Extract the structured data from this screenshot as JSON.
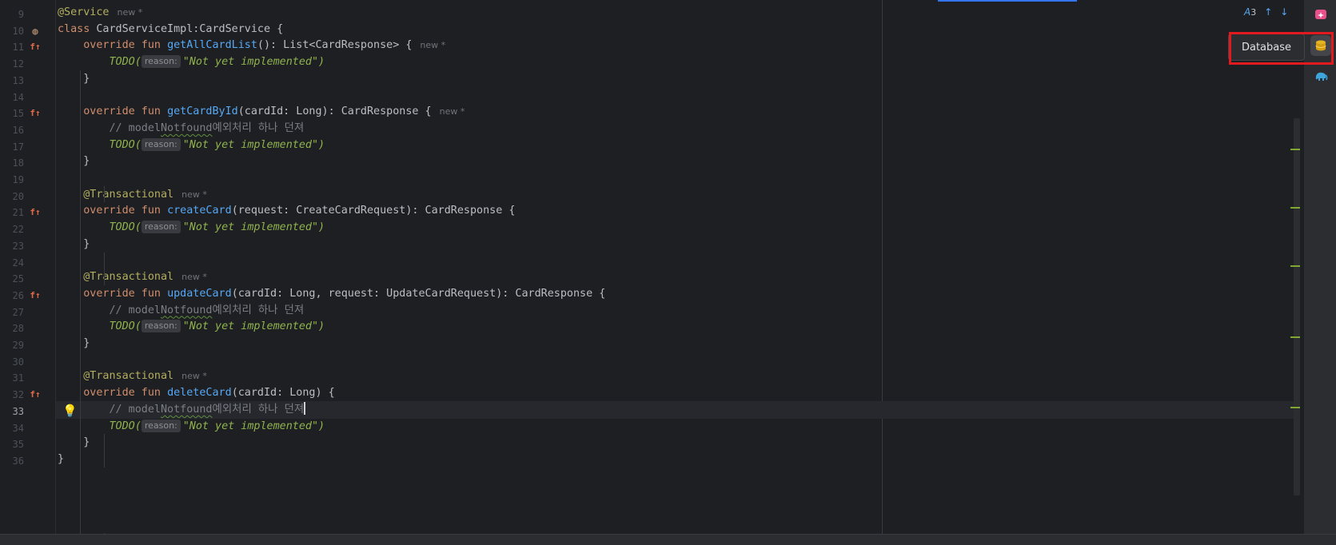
{
  "editor": {
    "active_line": 33,
    "lines": [
      {
        "n": "9",
        "segs": [
          [
            "an",
            "@Service"
          ]
        ],
        "hint": "new *"
      },
      {
        "n": "10",
        "icon": "bean",
        "segs": [
          [
            "kw",
            "class "
          ],
          [
            "",
            "CardServiceImpl:CardService {"
          ]
        ]
      },
      {
        "n": "11",
        "icon": "impl",
        "segs": [
          [
            "",
            "    "
          ],
          [
            "kw",
            "override fun "
          ],
          [
            "fn",
            "getAllCardList"
          ],
          [
            "",
            "(): List<CardResponse> {"
          ]
        ],
        "hint": "new *"
      },
      {
        "n": "12",
        "segs": [
          [
            "",
            "        "
          ],
          [
            "todo",
            "TODO("
          ],
          [
            "hint",
            "reason:"
          ],
          [
            "str",
            "\"Not yet implemented\")"
          ]
        ]
      },
      {
        "n": "13",
        "segs": [
          [
            "",
            "    }"
          ]
        ]
      },
      {
        "n": "14",
        "segs": []
      },
      {
        "n": "15",
        "icon": "impl",
        "segs": [
          [
            "",
            "    "
          ],
          [
            "kw",
            "override fun "
          ],
          [
            "fn",
            "getCardById"
          ],
          [
            "",
            "(cardId: Long): CardResponse {"
          ]
        ],
        "hint": "new *"
      },
      {
        "n": "16",
        "segs": [
          [
            "",
            "        "
          ],
          [
            "cm",
            "// model"
          ],
          [
            "cmtypo",
            "Notfound"
          ],
          [
            "cm",
            "예외처리 하나 던져"
          ]
        ]
      },
      {
        "n": "17",
        "segs": [
          [
            "",
            "        "
          ],
          [
            "todo",
            "TODO("
          ],
          [
            "hint",
            "reason:"
          ],
          [
            "str",
            "\"Not yet implemented\")"
          ]
        ]
      },
      {
        "n": "18",
        "segs": [
          [
            "",
            "    }"
          ]
        ]
      },
      {
        "n": "19",
        "segs": []
      },
      {
        "n": "20",
        "segs": [
          [
            "",
            "    "
          ],
          [
            "an",
            "@Transactional"
          ]
        ],
        "hint": "new *"
      },
      {
        "n": "21",
        "icon": "impl",
        "segs": [
          [
            "",
            "    "
          ],
          [
            "kw",
            "override fun "
          ],
          [
            "fn",
            "createCard"
          ],
          [
            "",
            "(request: CreateCardRequest): CardResponse {"
          ]
        ]
      },
      {
        "n": "22",
        "segs": [
          [
            "",
            "        "
          ],
          [
            "todo",
            "TODO("
          ],
          [
            "hint",
            "reason:"
          ],
          [
            "str",
            "\"Not yet implemented\")"
          ]
        ]
      },
      {
        "n": "23",
        "segs": [
          [
            "",
            "    }"
          ]
        ]
      },
      {
        "n": "24",
        "segs": []
      },
      {
        "n": "25",
        "segs": [
          [
            "",
            "    "
          ],
          [
            "an",
            "@Transactional"
          ]
        ],
        "hint": "new *"
      },
      {
        "n": "26",
        "icon": "impl",
        "segs": [
          [
            "",
            "    "
          ],
          [
            "kw",
            "override fun "
          ],
          [
            "fn",
            "updateCard"
          ],
          [
            "",
            "(cardId: Long, request: UpdateCardRequest): CardResponse {"
          ]
        ]
      },
      {
        "n": "27",
        "segs": [
          [
            "",
            "        "
          ],
          [
            "cm",
            "// model"
          ],
          [
            "cmtypo",
            "Notfound"
          ],
          [
            "cm",
            "예외처리 하나 던져"
          ]
        ]
      },
      {
        "n": "28",
        "segs": [
          [
            "",
            "        "
          ],
          [
            "todo",
            "TODO("
          ],
          [
            "hint",
            "reason:"
          ],
          [
            "str",
            "\"Not yet implemented\")"
          ]
        ]
      },
      {
        "n": "29",
        "segs": [
          [
            "",
            "    }"
          ]
        ]
      },
      {
        "n": "30",
        "segs": []
      },
      {
        "n": "31",
        "segs": [
          [
            "",
            "    "
          ],
          [
            "an",
            "@Transactional"
          ]
        ],
        "hint": "new *"
      },
      {
        "n": "32",
        "icon": "impl",
        "segs": [
          [
            "",
            "    "
          ],
          [
            "kw",
            "override fun "
          ],
          [
            "fn",
            "deleteCard"
          ],
          [
            "",
            "(cardId: Long) {"
          ]
        ]
      },
      {
        "n": "33",
        "icon": "bulb",
        "caret": true,
        "segs": [
          [
            "",
            "        "
          ],
          [
            "cm",
            "// model"
          ],
          [
            "cmtypo",
            "Notfound"
          ],
          [
            "cm",
            "예외처리 하나 던져"
          ]
        ]
      },
      {
        "n": "34",
        "segs": [
          [
            "",
            "        "
          ],
          [
            "todo",
            "TODO("
          ],
          [
            "hint",
            "reason:"
          ],
          [
            "str",
            "\"Not yet implemented\")"
          ]
        ]
      },
      {
        "n": "35",
        "segs": [
          [
            "",
            "    }"
          ]
        ]
      },
      {
        "n": "36",
        "segs": [
          [
            "",
            "}"
          ]
        ]
      }
    ]
  },
  "inspections": {
    "typo_count": "3"
  },
  "tooltip": {
    "label": "Database"
  },
  "right_toolbar": [
    {
      "name": "ai-assistant-icon",
      "color": "#e94f8a"
    },
    {
      "name": "database-icon",
      "color": "#e6b422",
      "active": true
    },
    {
      "name": "elephant-icon",
      "color": "#3fa6dc"
    }
  ],
  "colors": {
    "keyword": "#cf8e6d",
    "function": "#56a8f5",
    "annotation": "#b3ae60",
    "string": "#8fb34d",
    "comment": "#7a7e85",
    "highlight_box": "#e2191f"
  }
}
